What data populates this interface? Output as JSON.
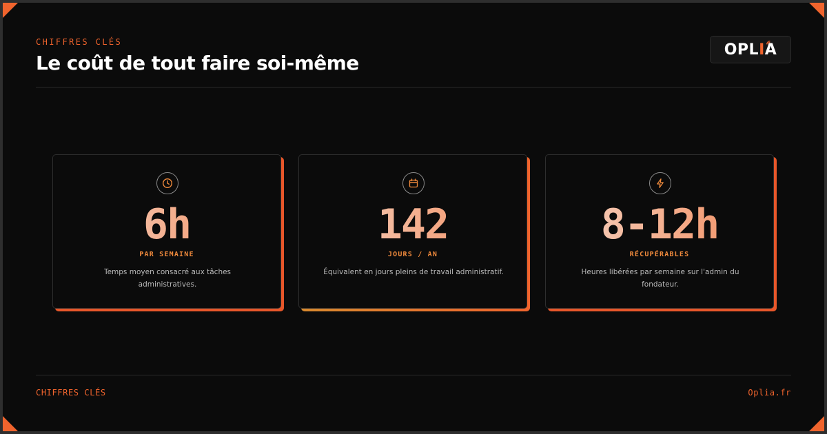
{
  "header": {
    "eyebrow": "CHIFFRES CLÉS",
    "title": "Le coût de tout faire soi-même"
  },
  "logo": {
    "text_main": "OPL",
    "text_accent": "I",
    "text_end": "A",
    "signal_icon": "broadcast-icon"
  },
  "cards": [
    {
      "icon": "clock-icon",
      "value": "6h",
      "label": "PAR SEMAINE",
      "description": "Temps moyen consacré aux tâches administratives."
    },
    {
      "icon": "calendar-icon",
      "value": "142",
      "label": "JOURS / AN",
      "description": "Équivalent en jours pleins de travail administratif."
    },
    {
      "icon": "lightning-icon",
      "value": "8-12h",
      "label": "RÉCUPÉRABLES",
      "description": "Heures libérées par semaine sur l'admin du fondateur."
    }
  ],
  "footer": {
    "left": "CHIFFRES CLÉS",
    "right": "Oplia.fr"
  },
  "colors": {
    "accent": "#f0642d",
    "accent_light": "#f08a3c",
    "background": "#0b0b0b",
    "card_border": "#2e2e2e"
  }
}
